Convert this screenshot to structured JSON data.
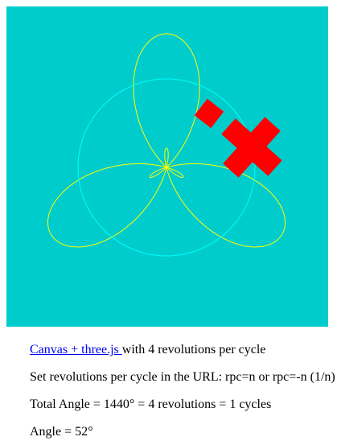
{
  "canvas": {
    "background_color": "#00cccc",
    "curve_color": "#ffff00",
    "circle_color": "#00ffff",
    "shape_color": "#ff0000"
  },
  "info": {
    "link_text": "Canvas + three.js ",
    "link_suffix": "with 4 revolutions per cycle",
    "url_hint": "Set revolutions per cycle in the URL: rpc=n or rpc=-n (1/n)",
    "total_angle": "Total Angle = 1440° = 4 revolutions = 1 cycles",
    "angle": "Angle = 52°"
  }
}
